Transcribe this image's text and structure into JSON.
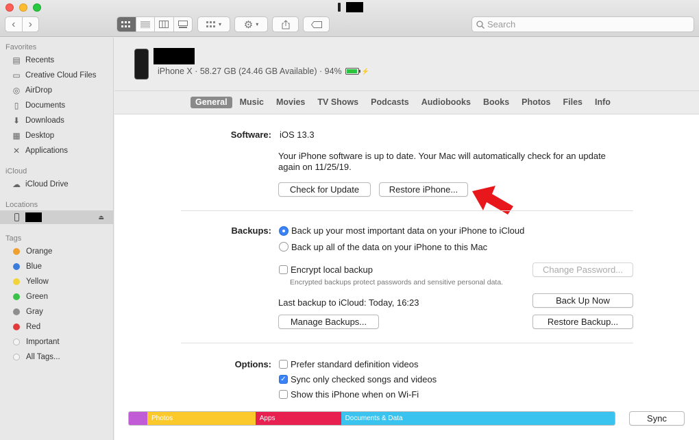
{
  "toolbar": {
    "search_placeholder": "Search"
  },
  "sidebar": {
    "favorites_header": "Favorites",
    "favorites": [
      {
        "label": "Recents",
        "icon": "recents-icon"
      },
      {
        "label": "Creative Cloud Files",
        "icon": "folder-icon"
      },
      {
        "label": "AirDrop",
        "icon": "airdrop-icon"
      },
      {
        "label": "Documents",
        "icon": "documents-icon"
      },
      {
        "label": "Downloads",
        "icon": "downloads-icon"
      },
      {
        "label": "Desktop",
        "icon": "desktop-icon"
      },
      {
        "label": "Applications",
        "icon": "applications-icon"
      }
    ],
    "icloud_header": "iCloud",
    "icloud_items": [
      {
        "label": "iCloud Drive",
        "icon": "cloud-icon"
      }
    ],
    "locations_header": "Locations",
    "tags_header": "Tags",
    "tags": [
      {
        "label": "Orange",
        "color": "#f0a030"
      },
      {
        "label": "Blue",
        "color": "#3b7ddd"
      },
      {
        "label": "Yellow",
        "color": "#f2d43a"
      },
      {
        "label": "Green",
        "color": "#3bc24a"
      },
      {
        "label": "Gray",
        "color": "#8e8e8e"
      },
      {
        "label": "Red",
        "color": "#e23b3b"
      },
      {
        "label": "Important",
        "color": "#e0e0e0"
      },
      {
        "label": "All Tags...",
        "color": "#e0e0e0"
      }
    ]
  },
  "device": {
    "info": "iPhone X · 58.27 GB (24.46 GB Available) · 94%",
    "battery_level": 0.94
  },
  "tabs": [
    "General",
    "Music",
    "Movies",
    "TV Shows",
    "Podcasts",
    "Audiobooks",
    "Books",
    "Photos",
    "Files",
    "Info"
  ],
  "software": {
    "label": "Software:",
    "version": "iOS 13.3",
    "status_line1": "Your iPhone software is up to date. Your Mac will automatically check for an update",
    "status_line2": "again on 11/25/19.",
    "check_update": "Check for Update",
    "restore": "Restore iPhone..."
  },
  "backups": {
    "label": "Backups:",
    "option_icloud": "Back up your most important data on your iPhone to iCloud",
    "option_mac": "Back up all of the data on your iPhone to this Mac",
    "encrypt": "Encrypt local backup",
    "encrypt_note": "Encrypted backups protect passwords and sensitive personal data.",
    "change_password": "Change Password...",
    "last_backup": "Last backup to iCloud:  Today, 16:23",
    "back_up_now": "Back Up Now",
    "manage": "Manage Backups...",
    "restore_backup": "Restore Backup..."
  },
  "options": {
    "label": "Options:",
    "prefer_sd": "Prefer standard definition videos",
    "sync_checked": "Sync only checked songs and videos",
    "show_wifi": "Show this iPhone when on Wi-Fi"
  },
  "storage": {
    "segments": [
      {
        "label": "",
        "color": "#c25bd6"
      },
      {
        "label": "Photos",
        "color": "#fbc92b"
      },
      {
        "label": "Apps",
        "color": "#e8204f"
      },
      {
        "label": "Documents & Data",
        "color": "#3ac3ef"
      }
    ],
    "sync": "Sync"
  },
  "colors": {
    "accent": "#3b82f6",
    "arrow": "#e8171b"
  }
}
